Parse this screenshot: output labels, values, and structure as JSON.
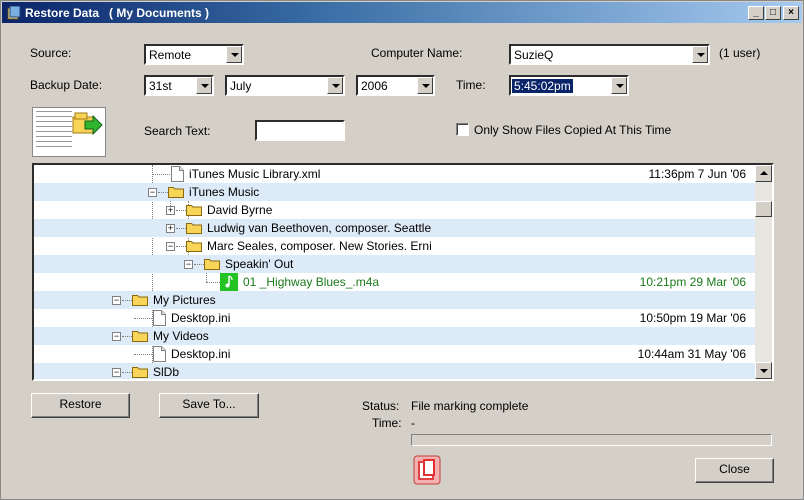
{
  "window": {
    "title": "Restore Data   ( My Documents )"
  },
  "titlebar_buttons": {
    "minimize": "_",
    "maximize": "□",
    "close": "×"
  },
  "form": {
    "source_label": "Source:",
    "source_value": "Remote",
    "computer_name_label": "Computer Name:",
    "computer_name_value": "SuzieQ",
    "user_count": "(1 user)",
    "backup_date_label": "Backup Date:",
    "day_value": "31st",
    "month_value": "July",
    "year_value": "2006",
    "time_label": "Time:",
    "time_value": "5:45:02pm",
    "search_label": "Search Text:",
    "search_value": "",
    "only_show_label": "Only Show Files Copied At This Time",
    "only_show_checked": false
  },
  "tree": {
    "rows": [
      {
        "name": "iTunes Music Library.xml",
        "date": "11:36pm 7 Jun '06",
        "type": "file"
      },
      {
        "name": "iTunes Music",
        "date": "",
        "type": "folder"
      },
      {
        "name": "David Byrne",
        "date": "",
        "type": "folder"
      },
      {
        "name": "Ludwig van Beethoven, composer. Seattle",
        "date": "",
        "type": "folder"
      },
      {
        "name": "Marc Seales, composer. New Stories. Erni",
        "date": "",
        "type": "folder"
      },
      {
        "name": "Speakin' Out",
        "date": "",
        "type": "folder"
      },
      {
        "name": "01 _Highway Blues_.m4a",
        "date": "10:21pm 29 Mar '06",
        "type": "audio"
      },
      {
        "name": "My Pictures",
        "date": "",
        "type": "folder"
      },
      {
        "name": "Desktop.ini",
        "date": "10:50pm 19 Mar '06",
        "type": "file"
      },
      {
        "name": "My Videos",
        "date": "",
        "type": "folder"
      },
      {
        "name": "Desktop.ini",
        "date": "10:44am 31 May '06",
        "type": "file"
      },
      {
        "name": "SlDb",
        "date": "",
        "type": "folder"
      }
    ]
  },
  "buttons": {
    "restore": "Restore",
    "save_to": "Save To...",
    "close": "Close"
  },
  "status": {
    "status_label": "Status:",
    "status_value": "File marking complete",
    "time_label": "Time:",
    "time_value": "-",
    "progress": 0
  },
  "colors": {
    "highlight": "#0a246a",
    "row_alt": "#ddeaf8",
    "copied_text": "#1a7a1a"
  },
  "icons": [
    "app-icon",
    "file-icon",
    "folder-icon",
    "audio-file-icon",
    "backup-thumbnail-icon",
    "stop-icon"
  ]
}
